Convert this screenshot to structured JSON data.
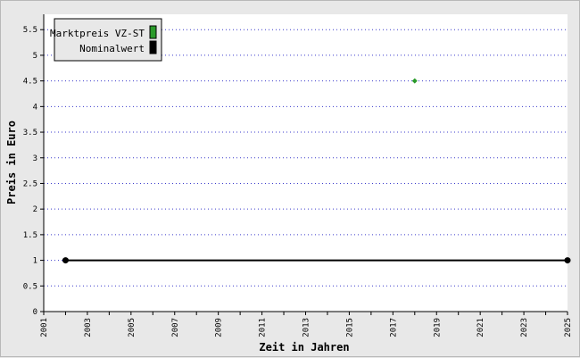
{
  "chart_data": {
    "type": "line",
    "xlabel": "Zeit in Jahren",
    "ylabel": "Preis in Euro",
    "xlim": [
      2001,
      2025
    ],
    "ylim": [
      0,
      5.8
    ],
    "x_ticks": [
      2001,
      2002,
      2003,
      2004,
      2005,
      2006,
      2007,
      2008,
      2009,
      2010,
      2011,
      2012,
      2013,
      2014,
      2015,
      2016,
      2017,
      2018,
      2019,
      2020,
      2021,
      2022,
      2023,
      2024,
      2025
    ],
    "x_tick_labels": [
      "2001",
      "2003",
      "2005",
      "2007",
      "2009",
      "2011",
      "2013",
      "2015",
      "2017",
      "2019",
      "2021",
      "2023",
      "2025"
    ],
    "y_ticks": [
      "0",
      "0.5",
      "1",
      "1.5",
      "2",
      "2.5",
      "3",
      "3.5",
      "4",
      "4.5",
      "5",
      "5.5"
    ],
    "grid": "horizontal dotted",
    "legend_position": "top-left",
    "series": [
      {
        "name": "Marktpreis VZ-ST",
        "color": "#2a9a2a",
        "marker": "diamond",
        "points": [
          {
            "x": 2018,
            "y": 4.5
          }
        ]
      },
      {
        "name": "Nominalwert",
        "color": "#000000",
        "marker": "circle",
        "points": [
          {
            "x": 2002,
            "y": 1
          },
          {
            "x": 2025,
            "y": 1
          }
        ]
      }
    ]
  }
}
